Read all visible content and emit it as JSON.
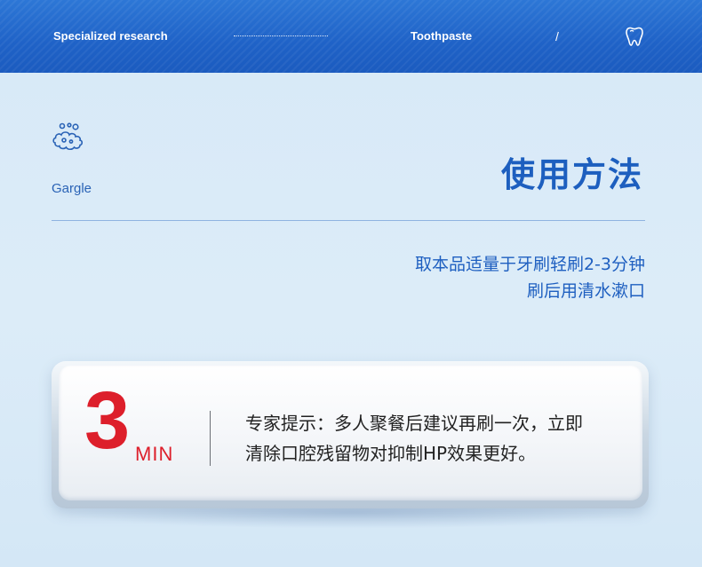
{
  "header": {
    "left_text": "Specialized research",
    "center_text": "Toothpaste",
    "separator": "/",
    "icon": "tooth-icon"
  },
  "feature": {
    "icon": "gargle-bubbles-icon",
    "label": "Gargle"
  },
  "title": "使用方法",
  "instructions": {
    "line1": "取本品适量于牙刷轻刷2-3分钟",
    "line2": "刷后用清水漱口"
  },
  "tip_card": {
    "number": "3",
    "unit": "MIN",
    "line1": "专家提示：多人聚餐后建议再刷一次，立即",
    "line2": "清除口腔残留物对抑制HP效果更好。"
  },
  "colors": {
    "brand_blue": "#1d5fbf",
    "header_blue": "#2d77d6",
    "accent_red": "#dd1f2b",
    "background": "#d7e9f7"
  }
}
